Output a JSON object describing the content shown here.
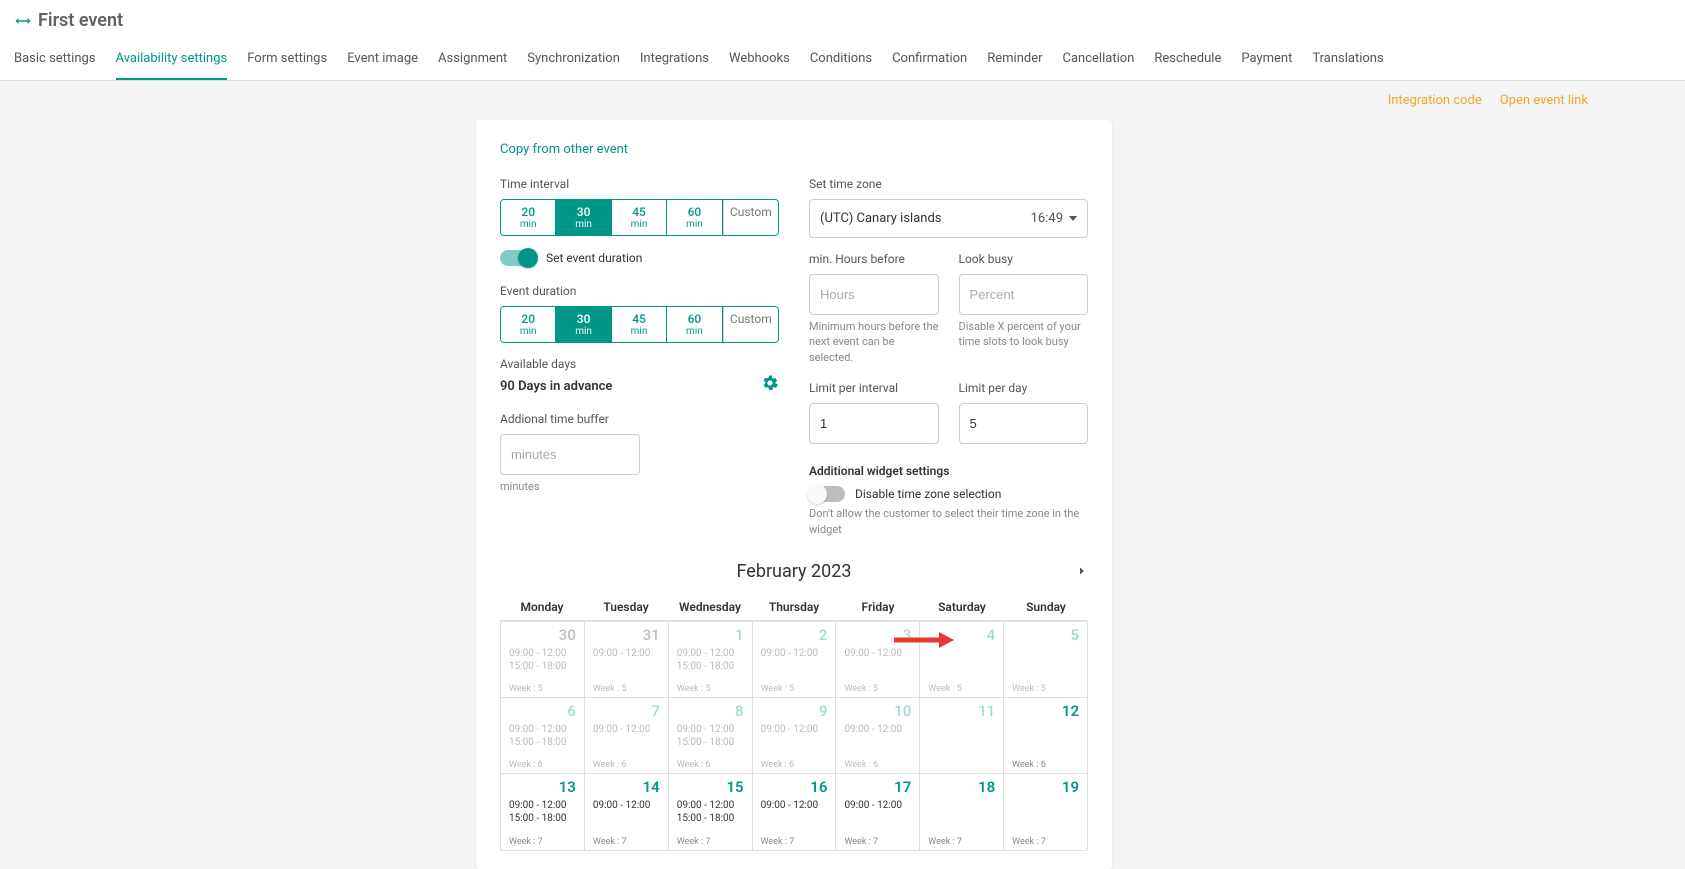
{
  "header": {
    "title": "First event"
  },
  "tabs": [
    {
      "label": "Basic settings",
      "active": false
    },
    {
      "label": "Availability settings",
      "active": true
    },
    {
      "label": "Form settings",
      "active": false
    },
    {
      "label": "Event image",
      "active": false
    },
    {
      "label": "Assignment",
      "active": false
    },
    {
      "label": "Synchronization",
      "active": false
    },
    {
      "label": "Integrations",
      "active": false
    },
    {
      "label": "Webhooks",
      "active": false
    },
    {
      "label": "Conditions",
      "active": false
    },
    {
      "label": "Confirmation",
      "active": false
    },
    {
      "label": "Reminder",
      "active": false
    },
    {
      "label": "Cancellation",
      "active": false
    },
    {
      "label": "Reschedule",
      "active": false
    },
    {
      "label": "Payment",
      "active": false
    },
    {
      "label": "Translations",
      "active": false
    }
  ],
  "links": {
    "integration_code": "Integration code",
    "open_event_link": "Open event link"
  },
  "panel": {
    "copy_from": "Copy from other event",
    "time_interval_label": "Time interval",
    "time_interval_options": [
      {
        "val": "20",
        "unit": "min",
        "active": false
      },
      {
        "val": "30",
        "unit": "min",
        "active": true
      },
      {
        "val": "45",
        "unit": "min",
        "active": false
      },
      {
        "val": "60",
        "unit": "min",
        "active": false
      }
    ],
    "custom_label": "Custom",
    "set_event_duration_label": "Set event duration",
    "event_duration_label": "Event duration",
    "event_duration_options": [
      {
        "val": "20",
        "unit": "min",
        "active": false
      },
      {
        "val": "30",
        "unit": "min",
        "active": true
      },
      {
        "val": "45",
        "unit": "min",
        "active": false
      },
      {
        "val": "60",
        "unit": "min",
        "active": false
      }
    ],
    "available_days_label": "Available days",
    "available_days_value": "90 Days in advance",
    "additional_buffer_label": "Addional time buffer",
    "additional_buffer_placeholder": "minutes",
    "additional_buffer_helper": "minutes",
    "timezone_label": "Set time zone",
    "timezone_value": "(UTC) Canary islands",
    "timezone_time": "16:49",
    "min_hours_label": "min. Hours before",
    "min_hours_placeholder": "Hours",
    "min_hours_helper": "Minimum hours before the next event can be selected.",
    "look_busy_label": "Look busy",
    "look_busy_placeholder": "Percent",
    "look_busy_helper": "Disable X percent of your time slots to look busy",
    "limit_interval_label": "Limit per interval",
    "limit_interval_value": "1",
    "limit_day_label": "Limit per day",
    "limit_day_value": "5",
    "add_widget_label": "Additional widget settings",
    "disable_tz_label": "Disable time zone selection",
    "disable_tz_helper": "Don't allow the customer to select their time zone in the widget"
  },
  "calendar": {
    "title": "February 2023",
    "days": [
      "Monday",
      "Tuesday",
      "Wednesday",
      "Thursday",
      "Friday",
      "Saturday",
      "Sunday"
    ],
    "rows": [
      [
        {
          "date": "30",
          "style": "past",
          "slots": [
            "09:00 - 12:00",
            "15:00 - 18:00"
          ],
          "week": "Week : 5"
        },
        {
          "date": "31",
          "style": "past",
          "slots": [
            "09:00 - 12:00"
          ],
          "week": "Week : 5"
        },
        {
          "date": "1",
          "style": "pastteal",
          "slots": [
            "09:00 - 12:00",
            "15:00 - 18:00"
          ],
          "week": "Week : 5"
        },
        {
          "date": "2",
          "style": "pastteal",
          "slots": [
            "09:00 - 12:00"
          ],
          "week": "Week : 5"
        },
        {
          "date": "3",
          "style": "pastteal",
          "slots": [
            "09:00 - 12:00"
          ],
          "week": "Week : 5"
        },
        {
          "date": "4",
          "style": "pastteal",
          "slots": [],
          "week": "Week : 5"
        },
        {
          "date": "5",
          "style": "pastteal",
          "slots": [],
          "week": "Week : 5"
        }
      ],
      [
        {
          "date": "6",
          "style": "pastteal",
          "slots": [
            "09:00 - 12:00",
            "15:00 - 18:00"
          ],
          "week": "Week : 6"
        },
        {
          "date": "7",
          "style": "pastteal",
          "slots": [
            "09:00 - 12:00"
          ],
          "week": "Week : 6"
        },
        {
          "date": "8",
          "style": "pastteal",
          "slots": [
            "09:00 - 12:00",
            "15:00 - 18:00"
          ],
          "week": "Week : 6"
        },
        {
          "date": "9",
          "style": "pastteal",
          "slots": [
            "09:00 - 12:00"
          ],
          "week": "Week : 6"
        },
        {
          "date": "10",
          "style": "pastteal",
          "slots": [
            "09:00 - 12:00"
          ],
          "week": "Week : 6"
        },
        {
          "date": "11",
          "style": "pastteal",
          "slots": [],
          "week": ""
        },
        {
          "date": "12",
          "style": "future",
          "slots": [],
          "week": "Week : 6"
        }
      ],
      [
        {
          "date": "13",
          "style": "future",
          "slots": [
            "09:00 - 12:00",
            "15:00 - 18:00"
          ],
          "week": "Week : 7"
        },
        {
          "date": "14",
          "style": "future",
          "slots": [
            "09:00 - 12:00"
          ],
          "week": "Week : 7"
        },
        {
          "date": "15",
          "style": "future",
          "slots": [
            "09:00 - 12:00",
            "15:00 - 18:00"
          ],
          "week": "Week : 7"
        },
        {
          "date": "16",
          "style": "future",
          "slots": [
            "09:00 - 12:00"
          ],
          "week": "Week : 7"
        },
        {
          "date": "17",
          "style": "future",
          "slots": [
            "09:00 - 12:00"
          ],
          "week": "Week : 7"
        },
        {
          "date": "18",
          "style": "future",
          "slots": [],
          "week": "Week : 7"
        },
        {
          "date": "19",
          "style": "future",
          "slots": [],
          "week": "Week : 7"
        }
      ]
    ]
  }
}
